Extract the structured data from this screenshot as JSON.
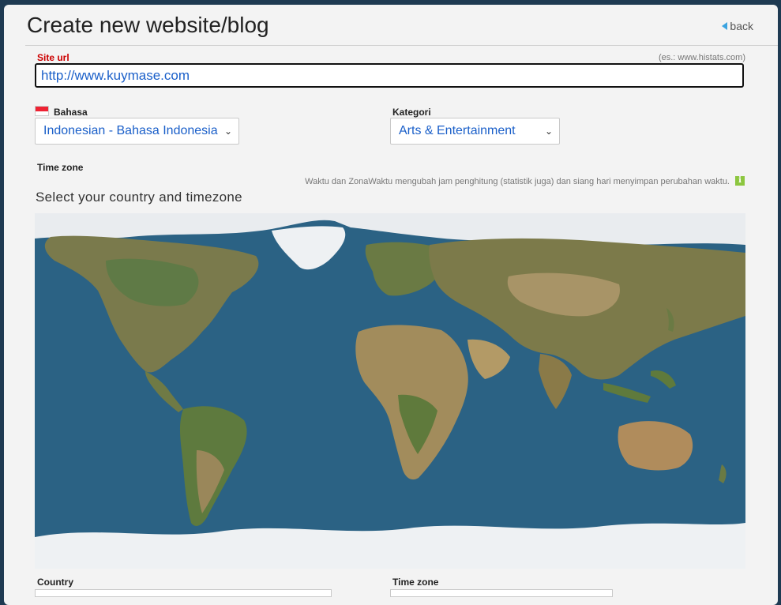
{
  "page": {
    "title": "Create new website/blog",
    "back_label": "back"
  },
  "site_url": {
    "label": "Site url",
    "hint": "(es.: www.histats.com)",
    "value": "http://www.kuymase.com"
  },
  "language": {
    "label": "Bahasa",
    "selected": "Indonesian - Bahasa Indonesia"
  },
  "category": {
    "label": "Kategori",
    "selected": "Arts & Entertainment"
  },
  "timezone_section": {
    "label": "Time zone",
    "note": "Waktu dan ZonaWaktu mengubah jam penghitung (statistik juga) dan siang hari menyimpan perubahan waktu.",
    "info_icon": "i",
    "map_title": "Select your country and timezone"
  },
  "bottom_fields": {
    "country_label": "Country",
    "timezone_label": "Time zone"
  },
  "colors": {
    "accent": "#1a5fc9",
    "required": "#cc0000",
    "info": "#8cc63f",
    "ocean": "#2c6385",
    "land": "#8a7a4e",
    "ice": "#eef1f3"
  }
}
